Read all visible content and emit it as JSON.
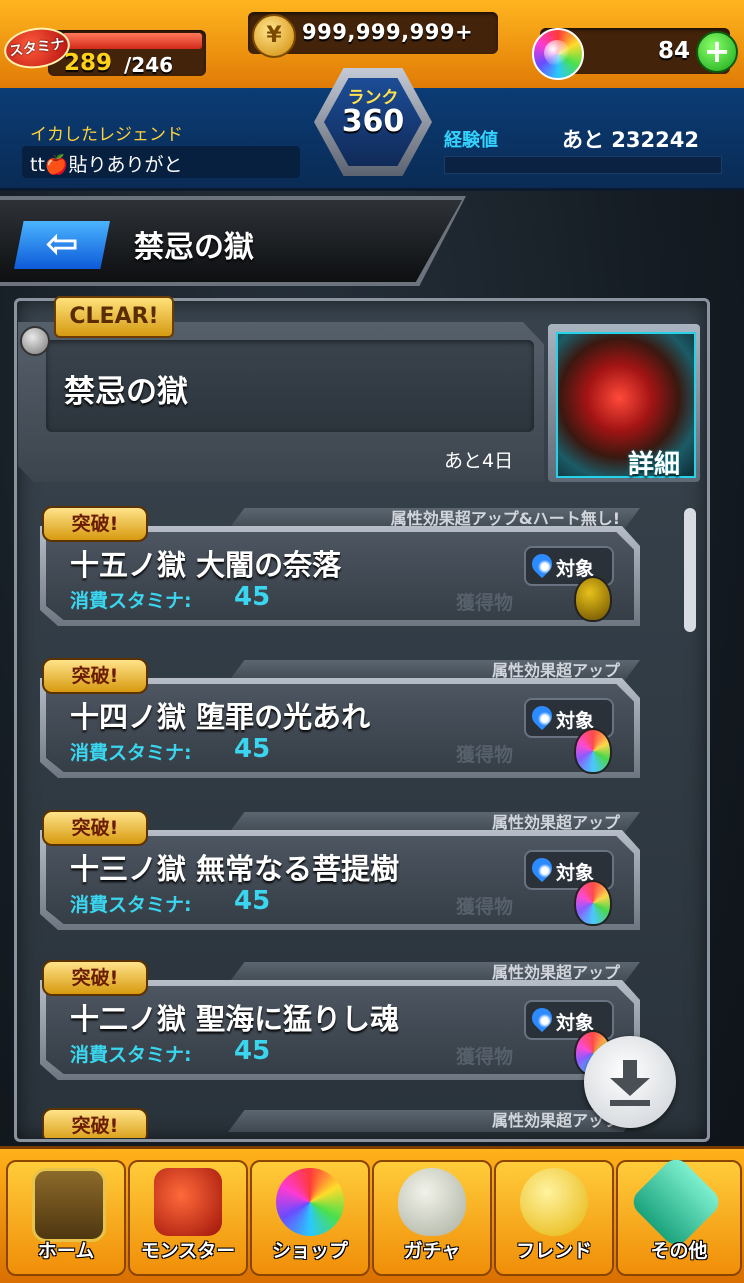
{
  "header": {
    "stamina_badge": "スタミナ",
    "stamina_current": "289",
    "stamina_max": "/246",
    "coins": "999,999,999+",
    "orb_count": "84",
    "plus_label": "+",
    "player_title": "イカしたレジェンド",
    "player_name": "tt🍎貼りありがと",
    "rank_label": "ランク",
    "rank_value": "360",
    "exp_label": "経験値",
    "exp_remaining": "あと 232242"
  },
  "title_bar": {
    "back_label": "⇦",
    "title": "禁忌の獄"
  },
  "event": {
    "clear_badge": "CLEAR!",
    "title": "禁忌の獄",
    "remaining": "あと4日",
    "details_label": "詳細"
  },
  "stages": [
    {
      "badge": "突破!",
      "tag": "属性効果超アップ&ハート無し!",
      "name": "十五ノ獄 大闇の奈落",
      "stamina_label": "消費スタミナ:",
      "stamina_cost": "45",
      "target_label": "対象",
      "reward_label": "獲得物",
      "reward_egg": "gold"
    },
    {
      "badge": "突破!",
      "tag": "属性効果超アップ",
      "name": "十四ノ獄 堕罪の光あれ",
      "stamina_label": "消費スタミナ:",
      "stamina_cost": "45",
      "target_label": "対象",
      "reward_label": "獲得物",
      "reward_egg": "rainbow"
    },
    {
      "badge": "突破!",
      "tag": "属性効果超アップ",
      "name": "十三ノ獄 無常なる菩提樹",
      "stamina_label": "消費スタミナ:",
      "stamina_cost": "45",
      "target_label": "対象",
      "reward_label": "獲得物",
      "reward_egg": "rainbow"
    },
    {
      "badge": "突破!",
      "tag": "属性効果超アップ",
      "name": "十二ノ獄 聖海に猛りし魂",
      "stamina_label": "消費スタミナ:",
      "stamina_cost": "45",
      "target_label": "対象",
      "reward_label": "獲得物",
      "reward_egg": "rainbow"
    },
    {
      "badge": "突破!",
      "tag": "属性効果超アップ"
    }
  ],
  "nav": [
    {
      "label": "ホーム",
      "icon": "home-icon"
    },
    {
      "label": "モンスター",
      "icon": "monster-icon"
    },
    {
      "label": "ショップ",
      "icon": "shop-orb-icon"
    },
    {
      "label": "ガチャ",
      "icon": "gacha-egg-icon"
    },
    {
      "label": "フレンド",
      "icon": "friend-balloon-icon"
    },
    {
      "label": "その他",
      "icon": "other-icon"
    }
  ],
  "colors": {
    "header_orange": "#ffb51f",
    "header_blue": "#0b3c75",
    "accent_cyan": "#3ad6ef",
    "badge_gold": "#ffe38a"
  }
}
